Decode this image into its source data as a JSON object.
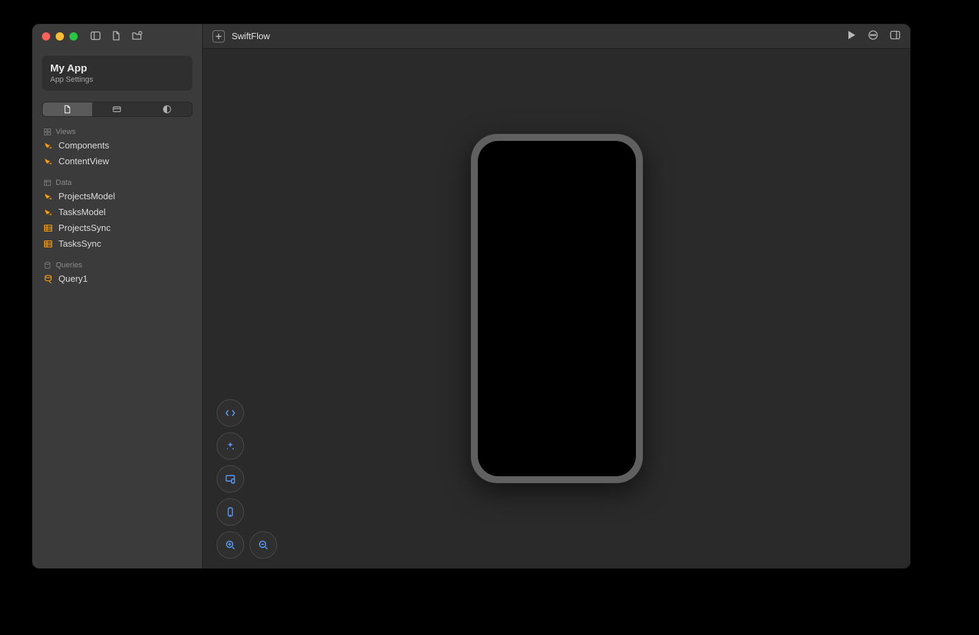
{
  "header": {
    "tab_title": "SwiftFlow"
  },
  "app": {
    "title": "My App",
    "subtitle": "App Settings"
  },
  "sidebar": {
    "sections": [
      {
        "label": "Views",
        "icon": "views-icon",
        "items": [
          {
            "label": "Components",
            "icon": "swift"
          },
          {
            "label": "ContentView",
            "icon": "swift"
          }
        ]
      },
      {
        "label": "Data",
        "icon": "data-icon",
        "items": [
          {
            "label": "ProjectsModel",
            "icon": "swift"
          },
          {
            "label": "TasksModel",
            "icon": "swift"
          },
          {
            "label": "ProjectsSync",
            "icon": "table"
          },
          {
            "label": "TasksSync",
            "icon": "table"
          }
        ]
      },
      {
        "label": "Queries",
        "icon": "queries-icon",
        "items": [
          {
            "label": "Query1",
            "icon": "query"
          }
        ]
      }
    ]
  },
  "tools": {
    "items": [
      "code",
      "magic",
      "screen",
      "device",
      "zoom-in",
      "zoom-out"
    ]
  },
  "colors": {
    "accent": "#5a9cff",
    "swift": "#ff9f0a",
    "table": "#ff9f0a",
    "query": "#ff9f0a"
  }
}
